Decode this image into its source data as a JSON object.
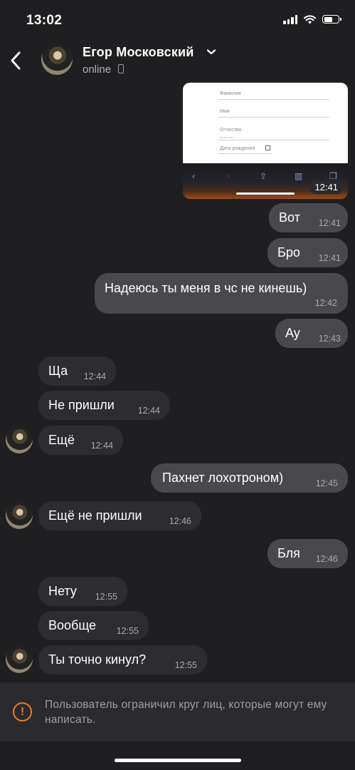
{
  "status_bar": {
    "time": "13:02"
  },
  "header": {
    "contact_name": "Егор Московский",
    "status": "online"
  },
  "screenshot_preview": {
    "field_labels": [
      "Фамилия",
      "Имя",
      "Отчество",
      "Дата рождения"
    ],
    "field_hint": "Если есть",
    "time": "12:41"
  },
  "messages": [
    {
      "direction": "out",
      "text": "Вот",
      "time": "12:41"
    },
    {
      "direction": "out",
      "text": "Бро",
      "time": "12:41"
    },
    {
      "direction": "out",
      "text": "Надеюсь ты меня в чс не кинешь)",
      "time": "12:42"
    },
    {
      "direction": "out",
      "text": "Ау",
      "time": "12:43"
    },
    {
      "direction": "in",
      "text": "Ща",
      "time": "12:44"
    },
    {
      "direction": "in",
      "text": "Не пришли",
      "time": "12:44"
    },
    {
      "direction": "in",
      "text": "Ещё",
      "time": "12:44"
    },
    {
      "direction": "out",
      "text": "Пахнет лохотроном)",
      "time": "12:45"
    },
    {
      "direction": "in",
      "text": "Ещё не пришли",
      "time": "12:46"
    },
    {
      "direction": "out",
      "text": "Бля",
      "time": "12:46"
    },
    {
      "direction": "in",
      "text": "Нету",
      "time": "12:55"
    },
    {
      "direction": "in",
      "text": "Вообще",
      "time": "12:55"
    },
    {
      "direction": "in",
      "text": "Ты точно кинул?",
      "time": "12:55"
    }
  ],
  "restriction_banner": {
    "icon": "warning-icon",
    "text": "Пользователь ограничил круг лиц, которые могут ему написать."
  },
  "colors": {
    "background": "#1f1e21",
    "outgoing_bubble": "#49484d",
    "incoming_bubble": "#2d2c31",
    "warning": "#e57f2c"
  }
}
